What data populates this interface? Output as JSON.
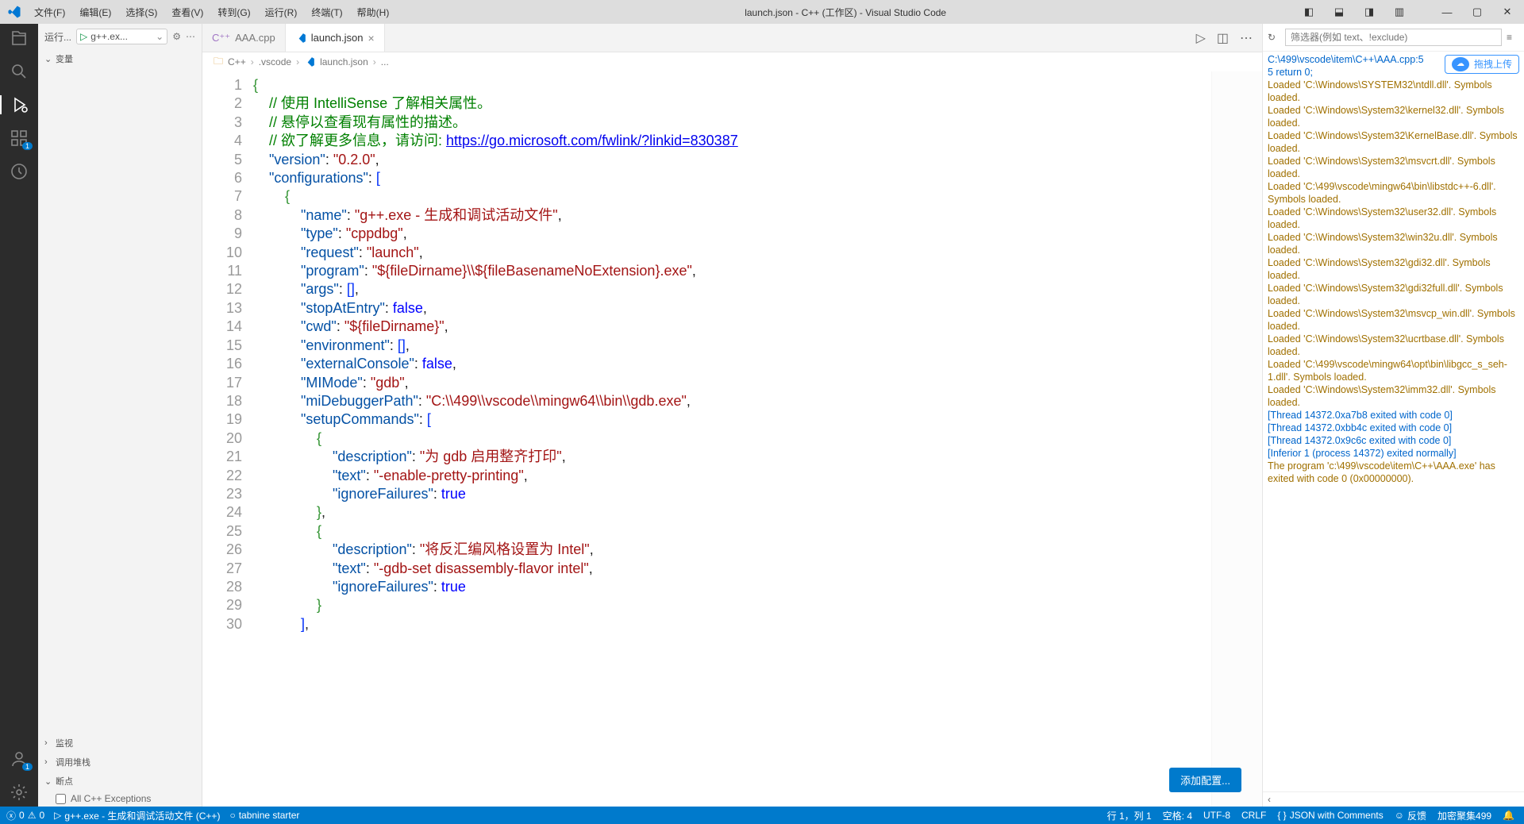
{
  "window": {
    "title": "launch.json - C++ (工作区) - Visual Studio Code"
  },
  "menu": [
    "文件(F)",
    "编辑(E)",
    "选择(S)",
    "查看(V)",
    "转到(G)",
    "运行(R)",
    "终端(T)",
    "帮助(H)"
  ],
  "sidebar": {
    "run_label": "运行...",
    "config": "g++.ex...",
    "sections": {
      "variables": "变量",
      "watch": "监视",
      "callstack": "调用堆栈",
      "breakpoints": "断点"
    },
    "breakpoint_checkbox": "All C++ Exceptions"
  },
  "tabs": [
    {
      "label": "AAA.cpp",
      "active": false
    },
    {
      "label": "launch.json",
      "active": true
    }
  ],
  "breadcrumb": [
    "C++",
    ".vscode",
    "launch.json",
    "..."
  ],
  "code_lines": [
    {
      "n": 1,
      "ind": 0,
      "t": [
        {
          "c": "brace",
          "s": "{"
        }
      ]
    },
    {
      "n": 2,
      "ind": 1,
      "t": [
        {
          "c": "comment",
          "s": "// 使用 IntelliSense 了解相关属性。"
        }
      ]
    },
    {
      "n": 3,
      "ind": 1,
      "t": [
        {
          "c": "comment",
          "s": "// 悬停以查看现有属性的描述。"
        }
      ]
    },
    {
      "n": 4,
      "ind": 1,
      "t": [
        {
          "c": "comment",
          "s": "// 欲了解更多信息，请访问: "
        },
        {
          "c": "link",
          "s": "https://go.microsoft.com/fwlink/?linkid=830387"
        }
      ]
    },
    {
      "n": 5,
      "ind": 1,
      "t": [
        {
          "c": "key",
          "s": "\"version\""
        },
        {
          "c": "punc",
          "s": ": "
        },
        {
          "c": "string",
          "s": "\"0.2.0\""
        },
        {
          "c": "punc",
          "s": ","
        }
      ]
    },
    {
      "n": 6,
      "ind": 1,
      "t": [
        {
          "c": "key",
          "s": "\"configurations\""
        },
        {
          "c": "punc",
          "s": ": "
        },
        {
          "c": "bracket",
          "s": "["
        }
      ]
    },
    {
      "n": 7,
      "ind": 2,
      "t": [
        {
          "c": "brace",
          "s": "{"
        }
      ]
    },
    {
      "n": 8,
      "ind": 3,
      "t": [
        {
          "c": "key",
          "s": "\"name\""
        },
        {
          "c": "punc",
          "s": ": "
        },
        {
          "c": "string",
          "s": "\"g++.exe - 生成和调试活动文件\""
        },
        {
          "c": "punc",
          "s": ","
        }
      ]
    },
    {
      "n": 9,
      "ind": 3,
      "t": [
        {
          "c": "key",
          "s": "\"type\""
        },
        {
          "c": "punc",
          "s": ": "
        },
        {
          "c": "string",
          "s": "\"cppdbg\""
        },
        {
          "c": "punc",
          "s": ","
        }
      ]
    },
    {
      "n": 10,
      "ind": 3,
      "t": [
        {
          "c": "key",
          "s": "\"request\""
        },
        {
          "c": "punc",
          "s": ": "
        },
        {
          "c": "string",
          "s": "\"launch\""
        },
        {
          "c": "punc",
          "s": ","
        }
      ]
    },
    {
      "n": 11,
      "ind": 3,
      "t": [
        {
          "c": "key",
          "s": "\"program\""
        },
        {
          "c": "punc",
          "s": ": "
        },
        {
          "c": "string",
          "s": "\"${fileDirname}\\\\${fileBasenameNoExtension}.exe\""
        },
        {
          "c": "punc",
          "s": ","
        }
      ]
    },
    {
      "n": 12,
      "ind": 3,
      "t": [
        {
          "c": "key",
          "s": "\"args\""
        },
        {
          "c": "punc",
          "s": ": "
        },
        {
          "c": "bracket",
          "s": "[]"
        },
        {
          "c": "punc",
          "s": ","
        }
      ]
    },
    {
      "n": 13,
      "ind": 3,
      "t": [
        {
          "c": "key",
          "s": "\"stopAtEntry\""
        },
        {
          "c": "punc",
          "s": ": "
        },
        {
          "c": "bool",
          "s": "false"
        },
        {
          "c": "punc",
          "s": ","
        }
      ]
    },
    {
      "n": 14,
      "ind": 3,
      "t": [
        {
          "c": "key",
          "s": "\"cwd\""
        },
        {
          "c": "punc",
          "s": ": "
        },
        {
          "c": "string",
          "s": "\"${fileDirname}\""
        },
        {
          "c": "punc",
          "s": ","
        }
      ]
    },
    {
      "n": 15,
      "ind": 3,
      "t": [
        {
          "c": "key",
          "s": "\"environment\""
        },
        {
          "c": "punc",
          "s": ": "
        },
        {
          "c": "bracket",
          "s": "[]"
        },
        {
          "c": "punc",
          "s": ","
        }
      ]
    },
    {
      "n": 16,
      "ind": 3,
      "t": [
        {
          "c": "key",
          "s": "\"externalConsole\""
        },
        {
          "c": "punc",
          "s": ": "
        },
        {
          "c": "bool",
          "s": "false"
        },
        {
          "c": "punc",
          "s": ","
        }
      ]
    },
    {
      "n": 17,
      "ind": 3,
      "t": [
        {
          "c": "key",
          "s": "\"MIMode\""
        },
        {
          "c": "punc",
          "s": ": "
        },
        {
          "c": "string",
          "s": "\"gdb\""
        },
        {
          "c": "punc",
          "s": ","
        }
      ]
    },
    {
      "n": 18,
      "ind": 3,
      "t": [
        {
          "c": "key",
          "s": "\"miDebuggerPath\""
        },
        {
          "c": "punc",
          "s": ": "
        },
        {
          "c": "string",
          "s": "\"C:\\\\499\\\\vscode\\\\mingw64\\\\bin\\\\gdb.exe\""
        },
        {
          "c": "punc",
          "s": ","
        }
      ]
    },
    {
      "n": 19,
      "ind": 3,
      "t": [
        {
          "c": "key",
          "s": "\"setupCommands\""
        },
        {
          "c": "punc",
          "s": ": "
        },
        {
          "c": "bracket",
          "s": "["
        }
      ]
    },
    {
      "n": 20,
      "ind": 4,
      "t": [
        {
          "c": "brace",
          "s": "{"
        }
      ]
    },
    {
      "n": 21,
      "ind": 5,
      "t": [
        {
          "c": "key",
          "s": "\"description\""
        },
        {
          "c": "punc",
          "s": ": "
        },
        {
          "c": "string",
          "s": "\"为 gdb 启用整齐打印\""
        },
        {
          "c": "punc",
          "s": ","
        }
      ]
    },
    {
      "n": 22,
      "ind": 5,
      "t": [
        {
          "c": "key",
          "s": "\"text\""
        },
        {
          "c": "punc",
          "s": ": "
        },
        {
          "c": "string",
          "s": "\"-enable-pretty-printing\""
        },
        {
          "c": "punc",
          "s": ","
        }
      ]
    },
    {
      "n": 23,
      "ind": 5,
      "t": [
        {
          "c": "key",
          "s": "\"ignoreFailures\""
        },
        {
          "c": "punc",
          "s": ": "
        },
        {
          "c": "bool",
          "s": "true"
        }
      ]
    },
    {
      "n": 24,
      "ind": 4,
      "t": [
        {
          "c": "brace",
          "s": "}"
        },
        {
          "c": "punc",
          "s": ","
        }
      ]
    },
    {
      "n": 25,
      "ind": 4,
      "t": [
        {
          "c": "brace",
          "s": "{"
        }
      ]
    },
    {
      "n": 26,
      "ind": 5,
      "t": [
        {
          "c": "key",
          "s": "\"description\""
        },
        {
          "c": "punc",
          "s": ": "
        },
        {
          "c": "string",
          "s": "\"将反汇编风格设置为 Intel\""
        },
        {
          "c": "punc",
          "s": ","
        }
      ]
    },
    {
      "n": 27,
      "ind": 5,
      "t": [
        {
          "c": "key",
          "s": "\"text\""
        },
        {
          "c": "punc",
          "s": ": "
        },
        {
          "c": "string",
          "s": "\"-gdb-set disassembly-flavor intel\""
        },
        {
          "c": "punc",
          "s": ","
        }
      ]
    },
    {
      "n": 28,
      "ind": 5,
      "t": [
        {
          "c": "key",
          "s": "\"ignoreFailures\""
        },
        {
          "c": "punc",
          "s": ": "
        },
        {
          "c": "bool",
          "s": "true"
        }
      ]
    },
    {
      "n": 29,
      "ind": 4,
      "t": [
        {
          "c": "brace",
          "s": "}"
        }
      ]
    },
    {
      "n": 30,
      "ind": 3,
      "t": [
        {
          "c": "bracket",
          "s": "]"
        },
        {
          "c": "punc",
          "s": ","
        }
      ]
    }
  ],
  "add_config_btn": "添加配置...",
  "filter_placeholder": "筛选器(例如 text、!exclude)",
  "upload_label": "拖拽上传",
  "output": [
    {
      "c": "b",
      "s": "C:\\499\\vscode\\item\\C++\\AAA.cpp:5"
    },
    {
      "c": "b",
      "s": "5               return 0;"
    },
    {
      "c": "y",
      "s": "Loaded 'C:\\Windows\\SYSTEM32\\ntdll.dll'. Symbols loaded."
    },
    {
      "c": "y",
      "s": "Loaded 'C:\\Windows\\System32\\kernel32.dll'. Symbols loaded."
    },
    {
      "c": "y",
      "s": "Loaded 'C:\\Windows\\System32\\KernelBase.dll'. Symbols loaded."
    },
    {
      "c": "y",
      "s": "Loaded 'C:\\Windows\\System32\\msvcrt.dll'. Symbols loaded."
    },
    {
      "c": "y",
      "s": "Loaded 'C:\\499\\vscode\\mingw64\\bin\\libstdc++-6.dll'. Symbols loaded."
    },
    {
      "c": "y",
      "s": "Loaded 'C:\\Windows\\System32\\user32.dll'. Symbols loaded."
    },
    {
      "c": "y",
      "s": "Loaded 'C:\\Windows\\System32\\win32u.dll'. Symbols loaded."
    },
    {
      "c": "y",
      "s": "Loaded 'C:\\Windows\\System32\\gdi32.dll'. Symbols loaded."
    },
    {
      "c": "y",
      "s": "Loaded 'C:\\Windows\\System32\\gdi32full.dll'. Symbols loaded."
    },
    {
      "c": "y",
      "s": "Loaded 'C:\\Windows\\System32\\msvcp_win.dll'. Symbols loaded."
    },
    {
      "c": "y",
      "s": "Loaded 'C:\\Windows\\System32\\ucrtbase.dll'. Symbols loaded."
    },
    {
      "c": "y",
      "s": "Loaded 'C:\\499\\vscode\\mingw64\\opt\\bin\\libgcc_s_seh-1.dll'. Symbols loaded."
    },
    {
      "c": "y",
      "s": "Loaded 'C:\\Windows\\System32\\imm32.dll'. Symbols loaded."
    },
    {
      "c": "b",
      "s": "[Thread 14372.0xa7b8 exited with code 0]"
    },
    {
      "c": "b",
      "s": "[Thread 14372.0xbb4c exited with code 0]"
    },
    {
      "c": "b",
      "s": "[Thread 14372.0x9c6c exited with code 0]"
    },
    {
      "c": "b",
      "s": "[Inferior 1 (process 14372) exited normally]"
    },
    {
      "c": "y",
      "s": "The program 'c:\\499\\vscode\\item\\C++\\AAA.exe' has exited with code 0 (0x00000000)."
    }
  ],
  "status": {
    "errors": "0",
    "warnings": "0",
    "launch": "g++.exe - 生成和调试活动文件 (C++)",
    "tabnine": "tabnine starter",
    "ln_col": "行 1，列 1",
    "spaces": "空格: 4",
    "encoding": "UTF-8",
    "eol": "CRLF",
    "lang": "JSON with Comments",
    "feedback": "反馈",
    "watermark": "加密聚集499"
  }
}
